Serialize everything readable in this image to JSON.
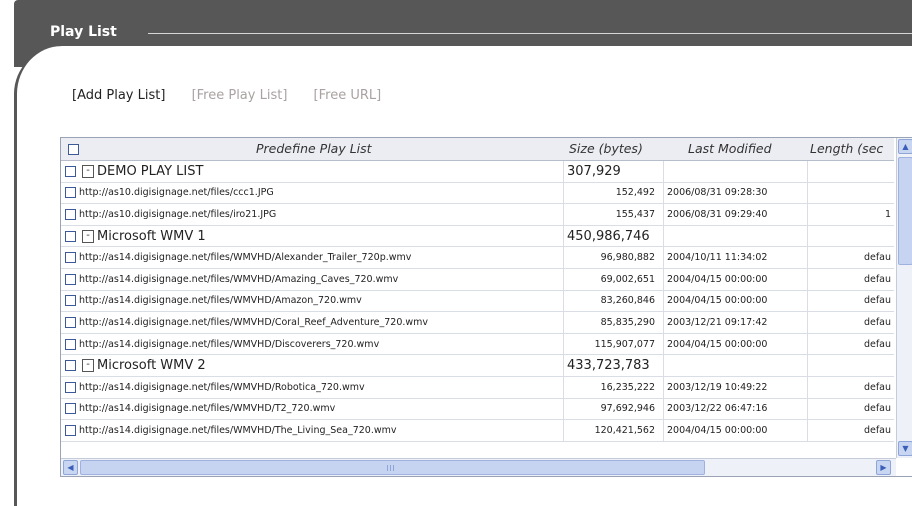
{
  "header": {
    "title": "Play List"
  },
  "actions": [
    {
      "label": "[Add Play List]",
      "enabled": true
    },
    {
      "label": "[Free Play List]",
      "enabled": false
    },
    {
      "label": "[Free URL]",
      "enabled": false
    }
  ],
  "table": {
    "columns": [
      "Predefine Play List",
      "Size (bytes)",
      "Last Modified",
      "Length (sec"
    ],
    "rows": [
      {
        "type": "group",
        "name": "DEMO PLAY LIST",
        "size": "307,929",
        "modified": "",
        "length": ""
      },
      {
        "type": "item",
        "name": "http://as10.digisignage.net/files/ccc1.JPG",
        "size": "152,492",
        "modified": "2006/08/31 09:28:30",
        "length": ""
      },
      {
        "type": "item",
        "name": "http://as10.digisignage.net/files/iro21.JPG",
        "size": "155,437",
        "modified": "2006/08/31 09:29:40",
        "length": "1"
      },
      {
        "type": "group",
        "name": "Microsoft WMV 1",
        "size": "450,986,746",
        "modified": "",
        "length": ""
      },
      {
        "type": "item",
        "name": "http://as14.digisignage.net/files/WMVHD/Alexander_Trailer_720p.wmv",
        "size": "96,980,882",
        "modified": "2004/10/11 11:34:02",
        "length": "defau"
      },
      {
        "type": "item",
        "name": "http://as14.digisignage.net/files/WMVHD/Amazing_Caves_720.wmv",
        "size": "69,002,651",
        "modified": "2004/04/15 00:00:00",
        "length": "defau"
      },
      {
        "type": "item",
        "name": "http://as14.digisignage.net/files/WMVHD/Amazon_720.wmv",
        "size": "83,260,846",
        "modified": "2004/04/15 00:00:00",
        "length": "defau"
      },
      {
        "type": "item",
        "name": "http://as14.digisignage.net/files/WMVHD/Coral_Reef_Adventure_720.wmv",
        "size": "85,835,290",
        "modified": "2003/12/21 09:17:42",
        "length": "defau"
      },
      {
        "type": "item",
        "name": "http://as14.digisignage.net/files/WMVHD/Discoverers_720.wmv",
        "size": "115,907,077",
        "modified": "2004/04/15 00:00:00",
        "length": "defau"
      },
      {
        "type": "group",
        "name": "Microsoft WMV 2",
        "size": "433,723,783",
        "modified": "",
        "length": ""
      },
      {
        "type": "item",
        "name": "http://as14.digisignage.net/files/WMVHD/Robotica_720.wmv",
        "size": "16,235,222",
        "modified": "2003/12/19 10:49:22",
        "length": "defau"
      },
      {
        "type": "item",
        "name": "http://as14.digisignage.net/files/WMVHD/T2_720.wmv",
        "size": "97,692,946",
        "modified": "2003/12/22 06:47:16",
        "length": "defau"
      },
      {
        "type": "item",
        "name": "http://as14.digisignage.net/files/WMVHD/The_Living_Sea_720.wmv",
        "size": "120,421,562",
        "modified": "2004/04/15 00:00:00",
        "length": "defau"
      }
    ]
  },
  "scrollbar_icons": {
    "up": "arrow-up-icon",
    "down": "arrow-down-icon",
    "left": "arrow-left-icon",
    "right": "arrow-right-icon"
  }
}
